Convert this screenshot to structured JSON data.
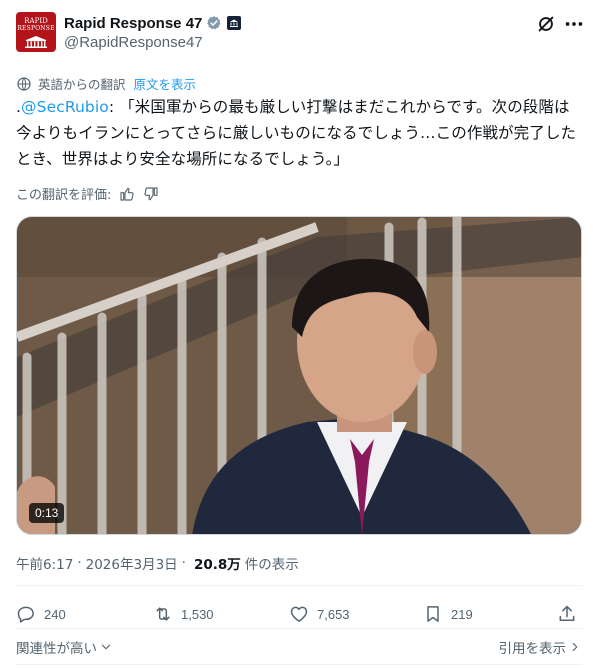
{
  "account": {
    "avatar_line1": "RAPID",
    "avatar_line2": "RESPONSE",
    "display_name": "Rapid Response 47",
    "handle": "@RapidResponse47"
  },
  "translation": {
    "label": "英語からの翻訳",
    "show_original": "原文を表示",
    "rate_label": "この翻訳を評価:"
  },
  "tweet": {
    "prefix": ".",
    "mention": "@SecRubio",
    "text": ": 「米国軍からの最も厳しい打撃はまだこれからです。次の段階は今よりもイランにとってさらに厳しいものになるでしょう…この作戦が完了したとき、世界はより安全な場所になるでしょう。」"
  },
  "video": {
    "duration": "0:13"
  },
  "meta": {
    "time": "午前6:17",
    "date": "2026年3月3日",
    "views": "20.8万",
    "views_label": "件の表示"
  },
  "actions": {
    "replies": "240",
    "reposts": "1,530",
    "likes": "7,653",
    "bookmarks": "219"
  },
  "footer": {
    "sort_label": "関連性が高い",
    "quotes_label": "引用を表示"
  },
  "icons": [
    "verified-badge-icon",
    "government-badge-icon",
    "grok-icon",
    "more-icon",
    "translate-icon",
    "thumbs-up-icon",
    "thumbs-down-icon",
    "reply-icon",
    "repost-icon",
    "like-icon",
    "bookmark-icon",
    "share-icon",
    "chevron-down-icon",
    "chevron-right-icon"
  ],
  "colors": {
    "accent": "#1d9bf0",
    "text": "#0f1419",
    "muted": "#536471",
    "avatar_bg": "#b3141c"
  }
}
